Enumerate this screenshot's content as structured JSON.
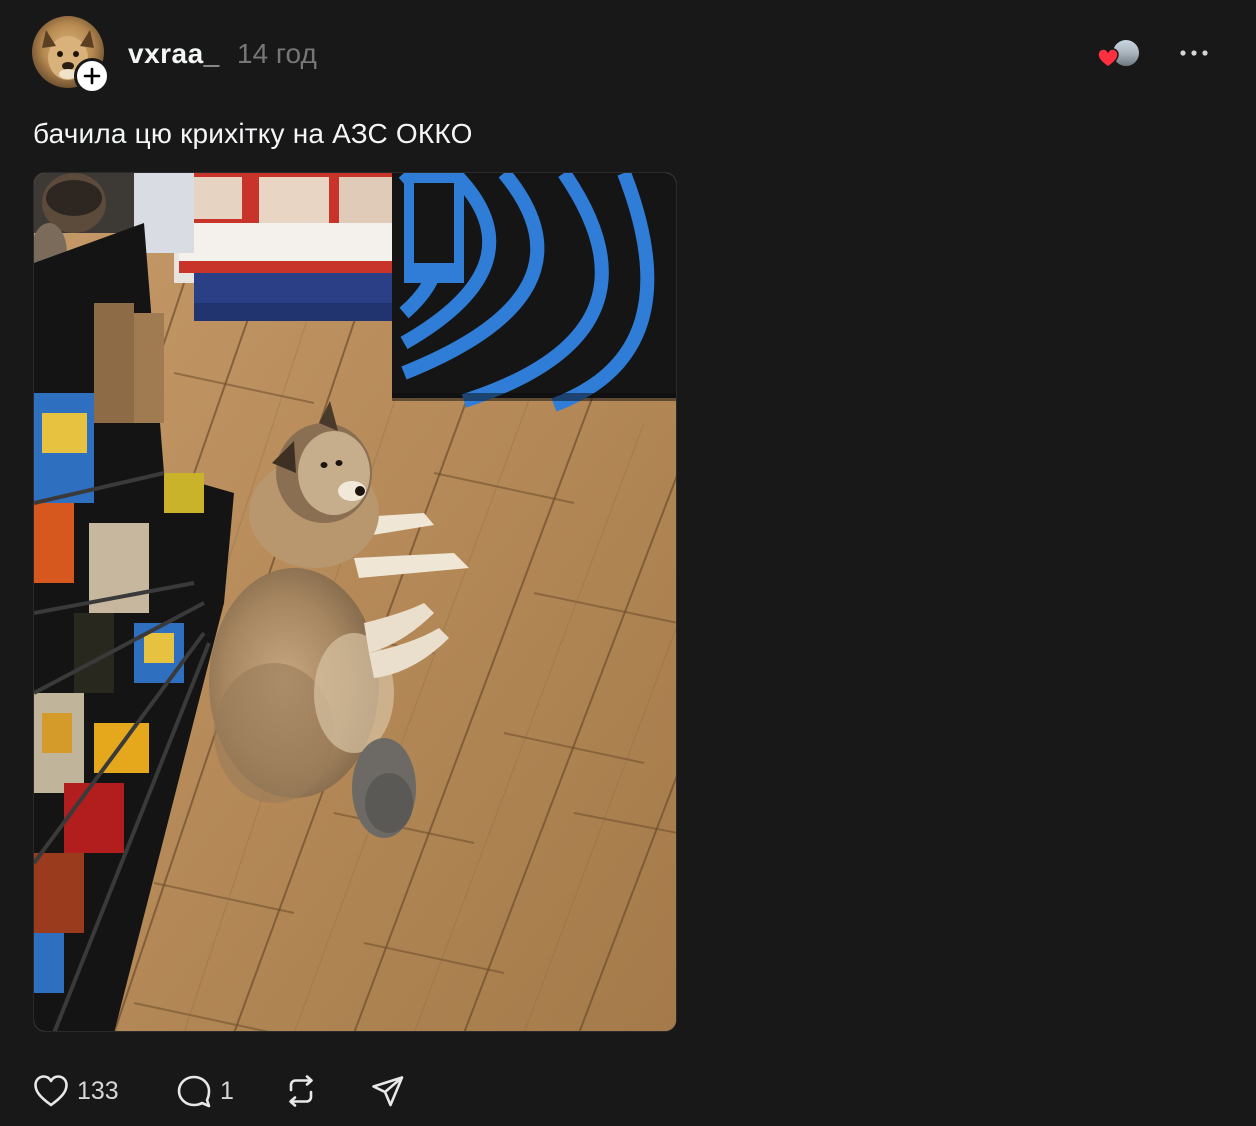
{
  "post": {
    "author": {
      "username": "vxraa_",
      "avatar_icon": "dog-avatar",
      "follow_icon": "plus-icon"
    },
    "timestamp": "14 год",
    "caption": "бачила цю крихітку на АЗС ОККО",
    "image": {
      "content": "dog-lying-on-wooden-floor-in-gas-station-store"
    },
    "likers": {
      "heart_icon": "heart-icon",
      "heart_color": "#ff3040"
    },
    "menu_icon": "more-icon",
    "actions": {
      "like": {
        "icon": "heart-outline-icon",
        "count": "133"
      },
      "reply": {
        "icon": "comment-icon",
        "count": "1"
      },
      "repost": {
        "icon": "repost-icon"
      },
      "share": {
        "icon": "send-icon"
      }
    }
  },
  "colors": {
    "background": "#181818",
    "text_primary": "#f3f5f7",
    "text_secondary": "#777777",
    "accent_heart": "#ff3040"
  }
}
